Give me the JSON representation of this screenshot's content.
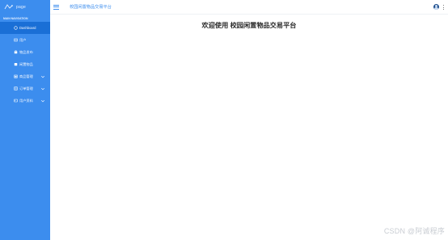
{
  "sidebar": {
    "logo_text": "page",
    "nav_header": "MAIN NAVIGATION",
    "items": [
      {
        "label": "Dashboard",
        "icon": "dashboard-icon"
      },
      {
        "label": "用户",
        "icon": "user-icon"
      },
      {
        "label": "物品发布",
        "icon": "publish-icon"
      },
      {
        "label": "闲置物品",
        "icon": "idle-items-icon"
      },
      {
        "label": "商品管理",
        "icon": "goods-icon",
        "expandable": true
      },
      {
        "label": "订单管理",
        "icon": "order-icon",
        "expandable": true
      },
      {
        "label": "用户资料",
        "icon": "profile-icon",
        "expandable": true
      }
    ],
    "bg_color": "#3c8dee",
    "active_color": "#1a6fd6"
  },
  "header": {
    "title": "校园闲置物品交易平台"
  },
  "main": {
    "welcome": "欢迎使用 校园闲置物品交易平台"
  },
  "watermark": "CSDN @阿诚程序"
}
